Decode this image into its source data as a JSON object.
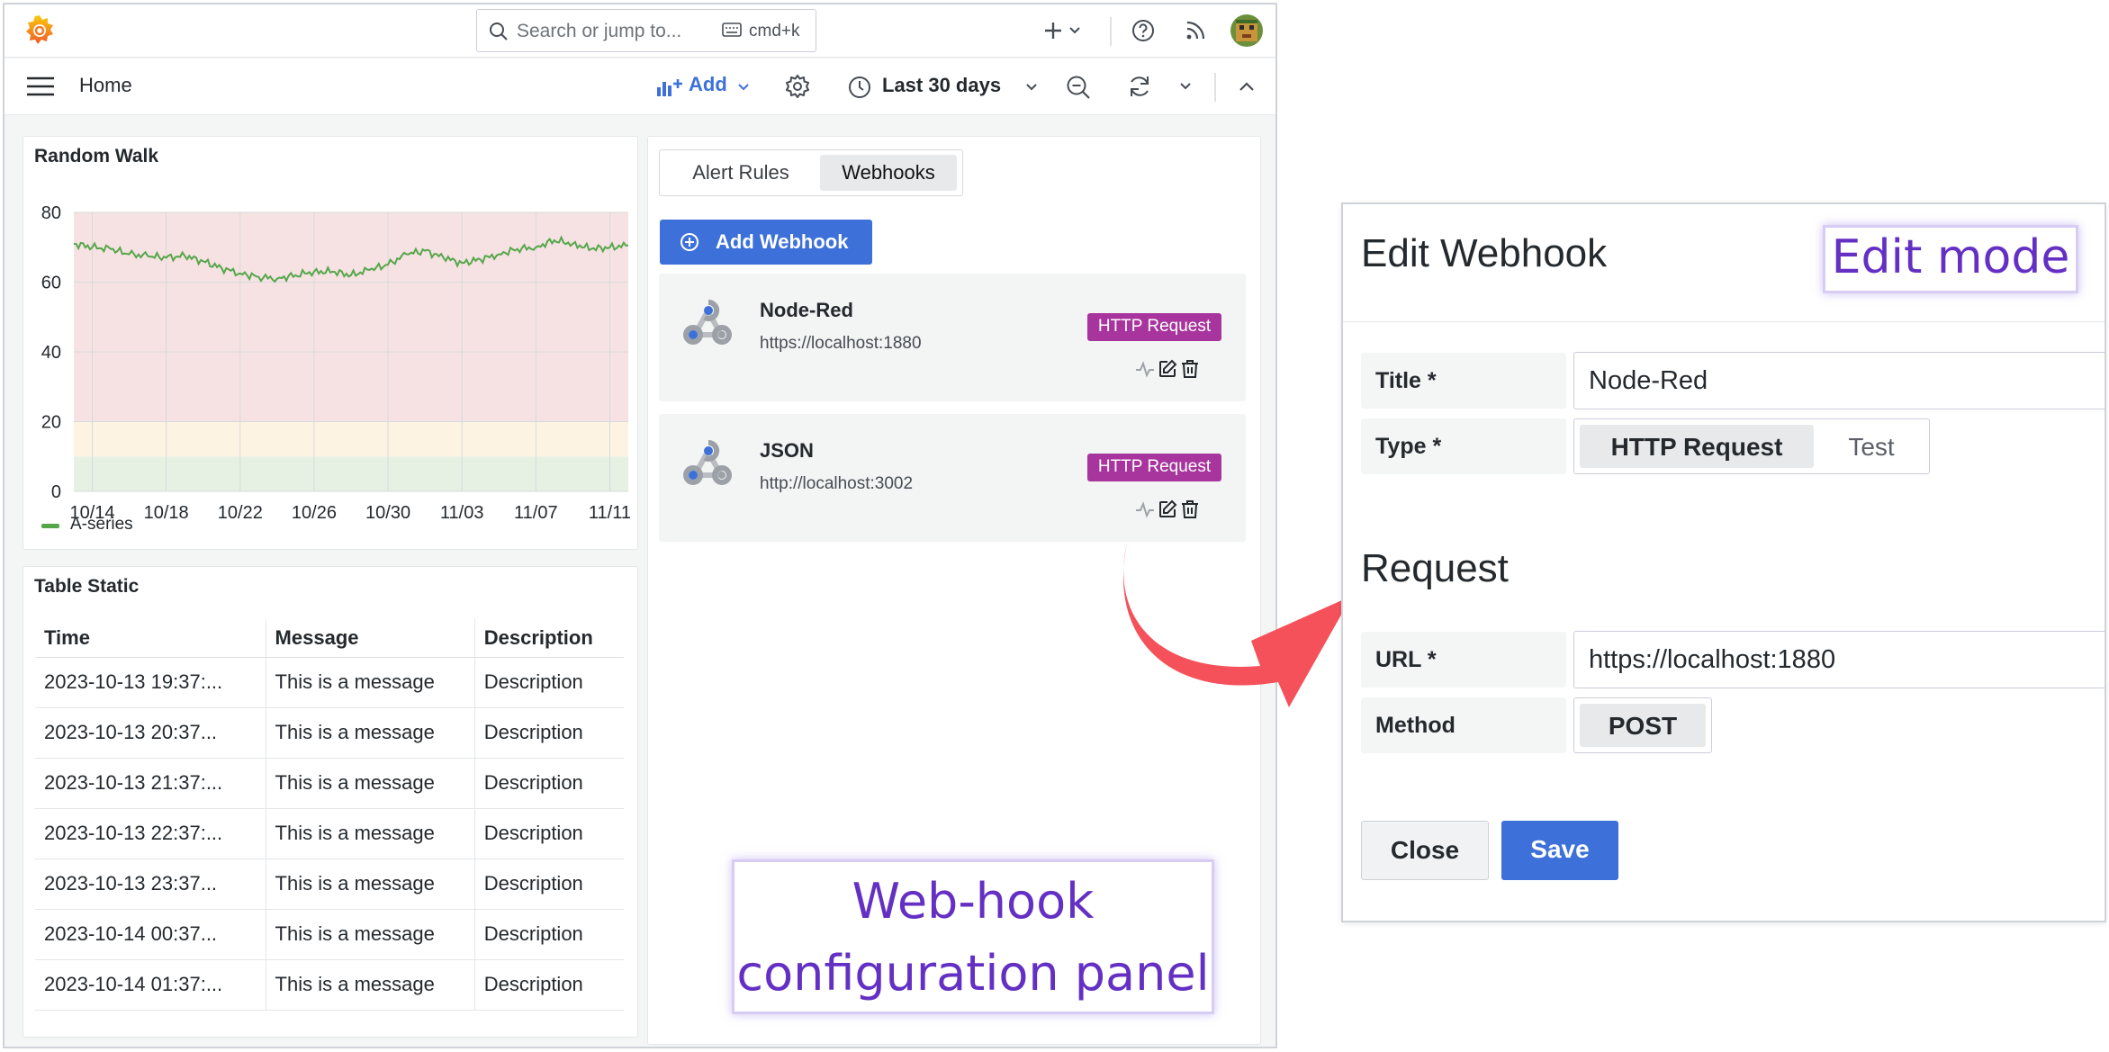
{
  "topbar": {
    "search_placeholder": "Search or jump to...",
    "search_shortcut": "cmd+k"
  },
  "navbar": {
    "breadcrumb": "Home",
    "add_label": "Add",
    "time_range": "Last 30 days"
  },
  "chart_panel": {
    "title": "Random Walk",
    "legend": "A-series"
  },
  "chart_data": {
    "type": "line",
    "title": "Random Walk",
    "x_ticks": [
      "10/14",
      "10/18",
      "10/22",
      "10/26",
      "10/30",
      "11/03",
      "11/07",
      "11/11"
    ],
    "y_ticks": [
      0,
      20,
      40,
      60,
      80
    ],
    "ylim": [
      0,
      80
    ],
    "xlim_days": [
      "10/13",
      "11/12"
    ],
    "thresholds": [
      {
        "from": 0,
        "to": 10,
        "color": "#e6f1e3"
      },
      {
        "from": 10,
        "to": 20,
        "color": "#fcf3e2"
      },
      {
        "from": 20,
        "to": 80,
        "color": "#f6e2e2"
      }
    ],
    "series": [
      {
        "name": "A-series",
        "color": "#56a64b",
        "x": [
          "10/13",
          "10/14",
          "10/15",
          "10/16",
          "10/17",
          "10/18",
          "10/19",
          "10/20",
          "10/21",
          "10/22",
          "10/23",
          "10/24",
          "10/25",
          "10/26",
          "10/27",
          "10/28",
          "10/29",
          "10/30",
          "10/31",
          "11/01",
          "11/02",
          "11/03",
          "11/04",
          "11/05",
          "11/06",
          "11/07",
          "11/08",
          "11/09",
          "11/10",
          "11/11",
          "11/12"
        ],
        "values": [
          71,
          70,
          69.5,
          68,
          67.5,
          67,
          67.5,
          66,
          64,
          62.5,
          61.5,
          61,
          62,
          63,
          63,
          62,
          63.5,
          65,
          68,
          69,
          67,
          65.5,
          66.5,
          68,
          69.5,
          70,
          72,
          71,
          69.5,
          70,
          70.5
        ]
      }
    ],
    "grid": true
  },
  "table_panel": {
    "title": "Table Static",
    "columns": [
      "Time",
      "Message",
      "Description"
    ],
    "rows": [
      [
        "2023-10-13 19:37:...",
        "This is a message",
        "Description"
      ],
      [
        "2023-10-13 20:37...",
        "This is a message",
        "Description"
      ],
      [
        "2023-10-13 21:37:...",
        "This is a message",
        "Description"
      ],
      [
        "2023-10-13 22:37:...",
        "This is a message",
        "Description"
      ],
      [
        "2023-10-13 23:37...",
        "This is a message",
        "Description"
      ],
      [
        "2023-10-14 00:37...",
        "This is a message",
        "Description"
      ],
      [
        "2023-10-14 01:37:...",
        "This is a message",
        "Description"
      ]
    ]
  },
  "webhook_panel": {
    "tabs": [
      "Alert Rules",
      "Webhooks"
    ],
    "active_tab": "Webhooks",
    "add_button": "Add Webhook",
    "webhooks": [
      {
        "name": "Node-Red",
        "url": "https://localhost:1880",
        "badge": "HTTP Request"
      },
      {
        "name": "JSON",
        "url": "http://localhost:3002",
        "badge": "HTTP Request"
      }
    ]
  },
  "callouts": {
    "webhook_line1": "Web-hook",
    "webhook_line2": "configuration panel",
    "edit_mode": "Edit mode"
  },
  "edit_dialog": {
    "title": "Edit Webhook",
    "title_label": "Title *",
    "title_value": "Node-Red",
    "type_label": "Type *",
    "type_options": [
      "HTTP Request",
      "Test"
    ],
    "type_selected": "HTTP Request",
    "request_heading": "Request",
    "url_label": "URL *",
    "url_value": "https://localhost:1880",
    "method_label": "Method",
    "method_value": "POST",
    "close_label": "Close",
    "save_label": "Save"
  },
  "colors": {
    "primary": "#3d71d9",
    "badge": "#a8359d",
    "callout_text": "#6430c4",
    "arrow": "#f5515b"
  }
}
